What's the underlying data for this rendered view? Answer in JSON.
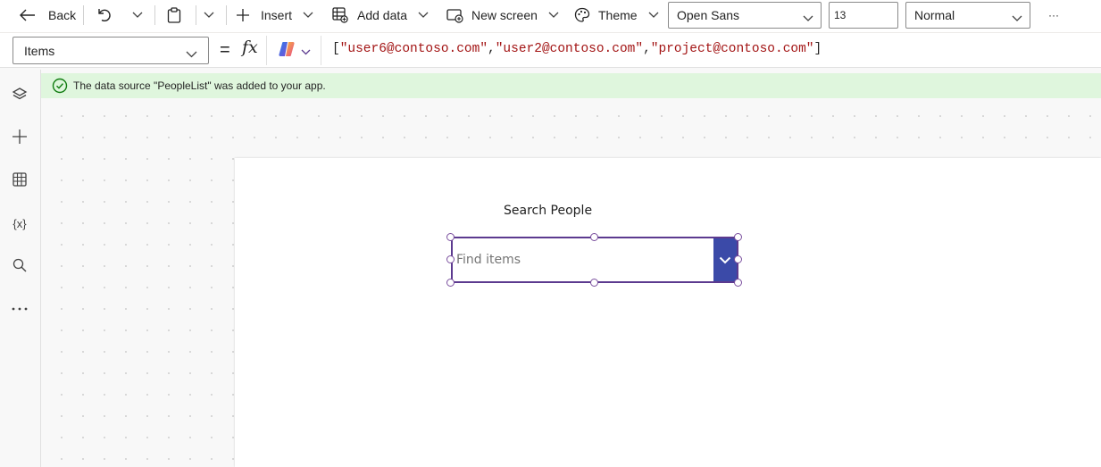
{
  "toolbar": {
    "back_label": "Back",
    "insert_label": "Insert",
    "add_data_label": "Add data",
    "new_screen_label": "New screen",
    "theme_label": "Theme",
    "font_family": "Open Sans",
    "font_size": "13",
    "font_weight": "Normal",
    "more_label": "···"
  },
  "formula_bar": {
    "property": "Items",
    "equals": "=",
    "fx": "fx",
    "open_bracket": "[",
    "values": [
      "\"user6@contoso.com\"",
      "\"user2@contoso.com\"",
      "\"project@contoso.com\""
    ],
    "separator": ",",
    "close_bracket": "]"
  },
  "notification": {
    "message": "The data source \"PeopleList\" was added to your app.",
    "status_color": "#107c10"
  },
  "rail": {
    "items": [
      {
        "icon": "layers-icon"
      },
      {
        "icon": "plus-icon"
      },
      {
        "icon": "table-icon"
      },
      {
        "icon": "variables-icon",
        "label": "{x}"
      },
      {
        "icon": "search-icon"
      },
      {
        "icon": "more-icon"
      }
    ]
  },
  "canvas": {
    "label_text": "Search People",
    "combobox_placeholder": "Find items",
    "accent_color": "#3b4aa8",
    "selection_color": "#5c3a8f"
  }
}
